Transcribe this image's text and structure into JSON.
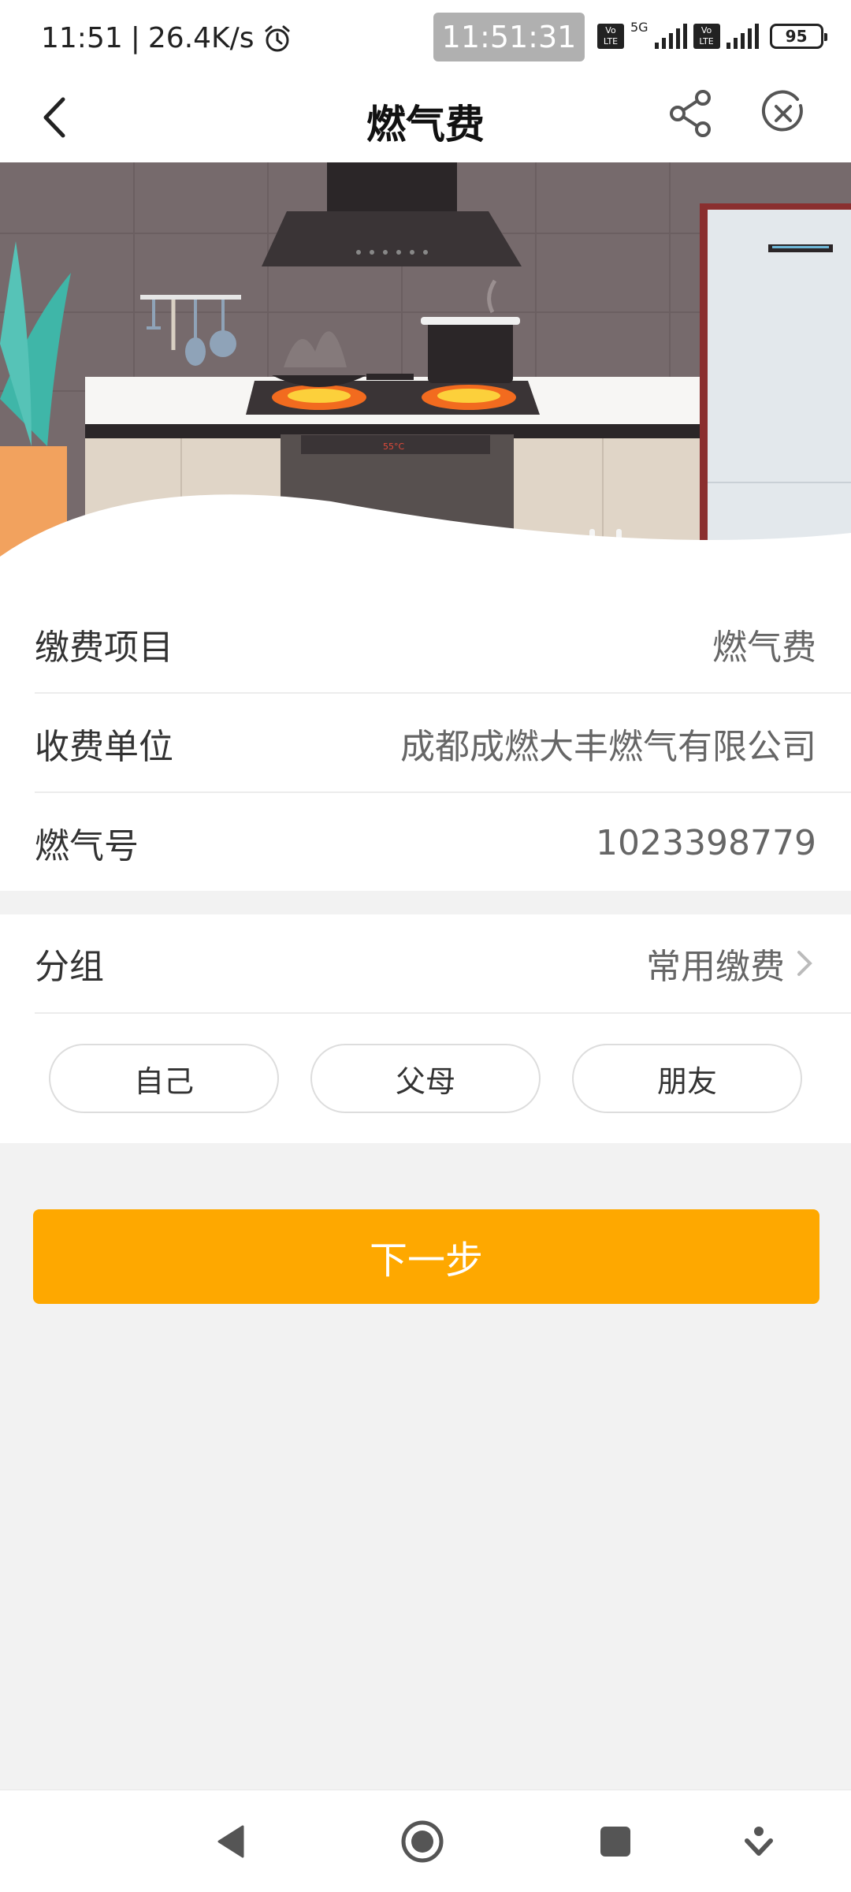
{
  "status_bar": {
    "time": "11:51",
    "net_speed": "26.4K/s",
    "clock_overlay": "11:51:31",
    "network": "5G",
    "volte_label": "Vo LTE",
    "battery": "95"
  },
  "header": {
    "title": "燃气费"
  },
  "info": {
    "rows": [
      {
        "label": "缴费项目",
        "value": "燃气费"
      },
      {
        "label": "收费单位",
        "value": "成都成燃大丰燃气有限公司"
      },
      {
        "label": "燃气号",
        "value": "1023398779"
      }
    ]
  },
  "group": {
    "label": "分组",
    "value": "常用缴费",
    "options": [
      "自己",
      "父母",
      "朋友"
    ]
  },
  "actions": {
    "next_label": "下一步"
  },
  "colors": {
    "accent": "#fea800",
    "background": "#f2f2f2"
  },
  "icons": {
    "back": "chevron-left-icon",
    "share": "share-icon",
    "close": "close-circle-icon",
    "alarm": "alarm-icon",
    "nav_back": "triangle-back-icon",
    "nav_home": "circle-home-icon",
    "nav_recent": "square-recent-icon",
    "nav_extra": "down-arrow-icon"
  }
}
